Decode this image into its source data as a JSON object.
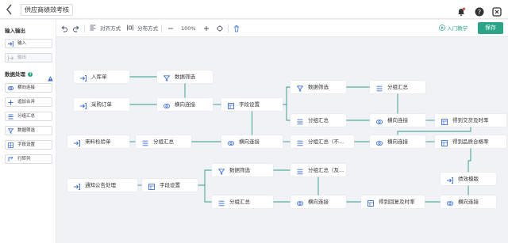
{
  "header": {
    "title": "供应商绩效考核"
  },
  "left_panel": {
    "io_title": "输入输出",
    "io_items": [
      {
        "label": "输入",
        "enabled": true
      },
      {
        "label": "输出",
        "enabled": false
      }
    ],
    "dp_title": "数据处理",
    "dp_items": [
      "横向连接",
      "追加合并",
      "分组汇总",
      "数据筛选",
      "字段设置",
      "行转列"
    ]
  },
  "toolbar": {
    "align_label": "对齐方式",
    "distribute_label": "分布方式",
    "zoom": "100%",
    "tutorial_label": "入门教学",
    "save_label": "保存"
  },
  "colors": {
    "accent": "#2ba488",
    "icon": "#3b6fe0",
    "wire": "#2e9a86"
  },
  "nodes": [
    {
      "label": "入库单",
      "icon": "input-icon"
    },
    {
      "label": "数据筛选",
      "icon": "filter-icon"
    },
    {
      "label": "采购订单",
      "icon": "input-icon"
    },
    {
      "label": "横向连接",
      "icon": "join-icon"
    },
    {
      "label": "字段设置",
      "icon": "field-settings-icon"
    },
    {
      "label": "数据筛选",
      "icon": "filter-icon"
    },
    {
      "label": "分组汇总",
      "icon": "group-summary-icon"
    },
    {
      "label": "分组汇总",
      "icon": "group-summary-icon"
    },
    {
      "label": "横向连接",
      "icon": "join-icon"
    },
    {
      "label": "得到交货及时率",
      "icon": "field-settings-icon"
    },
    {
      "label": "来料检验单",
      "icon": "input-icon"
    },
    {
      "label": "分组汇总",
      "icon": "group-summary-icon"
    },
    {
      "label": "横向连接",
      "icon": "join-icon"
    },
    {
      "label": "分组汇总（不...",
      "icon": "group-summary-icon"
    },
    {
      "label": "横向连接",
      "icon": "join-icon"
    },
    {
      "label": "得到品质合格率",
      "icon": "field-settings-icon"
    },
    {
      "label": "数据筛选",
      "icon": "filter-icon"
    },
    {
      "label": "分组汇总（及...",
      "icon": "group-summary-icon"
    },
    {
      "label": "通知公告处理",
      "icon": "input-icon"
    },
    {
      "label": "字段设置",
      "icon": "field-settings-icon"
    },
    {
      "label": "绩效模版",
      "icon": "input-icon"
    },
    {
      "label": "分组汇总",
      "icon": "group-summary-icon"
    },
    {
      "label": "横向连接",
      "icon": "join-icon"
    },
    {
      "label": "得到回复及时率",
      "icon": "field-settings-icon"
    },
    {
      "label": "横向连接",
      "icon": "join-icon"
    }
  ]
}
